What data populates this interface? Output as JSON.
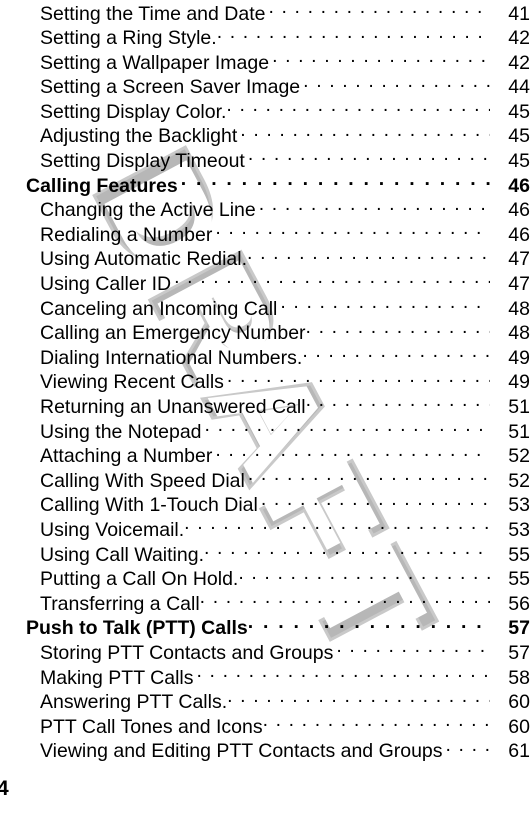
{
  "document": {
    "type": "table-of-contents",
    "watermark": "DRAFT",
    "watermark_color": "#b7b7b7",
    "folio": "4"
  },
  "toc": {
    "entries": [
      {
        "title": "Setting the Time and Date",
        "page": "41",
        "level": 2,
        "tight": false
      },
      {
        "title": "Setting a Ring Style.",
        "page": "42",
        "level": 2,
        "tight": true
      },
      {
        "title": "Setting a Wallpaper Image",
        "page": "42",
        "level": 2,
        "tight": false
      },
      {
        "title": "Setting a Screen Saver Image",
        "page": "44",
        "level": 2,
        "tight": false
      },
      {
        "title": "Setting Display Color.",
        "page": "45",
        "level": 2,
        "tight": true
      },
      {
        "title": "Adjusting the Backlight",
        "page": "45",
        "level": 2,
        "tight": false
      },
      {
        "title": "Setting Display Timeout",
        "page": "45",
        "level": 2,
        "tight": false
      },
      {
        "title": "Calling Features",
        "page": "46",
        "level": 1,
        "tight": false
      },
      {
        "title": "Changing the Active Line",
        "page": "46",
        "level": 2,
        "tight": false
      },
      {
        "title": "Redialing a Number",
        "page": "46",
        "level": 2,
        "tight": false
      },
      {
        "title": "Using Automatic Redial.",
        "page": "47",
        "level": 2,
        "tight": true
      },
      {
        "title": "Using Caller ID",
        "page": "47",
        "level": 2,
        "tight": false
      },
      {
        "title": "Canceling an Incoming Call",
        "page": "48",
        "level": 2,
        "tight": false
      },
      {
        "title": "Calling an Emergency Number",
        "page": "48",
        "level": 2,
        "tight": true
      },
      {
        "title": "Dialing International Numbers.",
        "page": "49",
        "level": 2,
        "tight": true
      },
      {
        "title": "Viewing Recent Calls",
        "page": "49",
        "level": 2,
        "tight": false
      },
      {
        "title": "Returning an Unanswered Call",
        "page": "51",
        "level": 2,
        "tight": true
      },
      {
        "title": "Using the Notepad",
        "page": "51",
        "level": 2,
        "tight": false
      },
      {
        "title": "Attaching a Number",
        "page": "52",
        "level": 2,
        "tight": false
      },
      {
        "title": "Calling With Speed Dial",
        "page": "52",
        "level": 2,
        "tight": false
      },
      {
        "title": "Calling With 1-Touch Dial",
        "page": "53",
        "level": 2,
        "tight": false
      },
      {
        "title": "Using Voicemail.",
        "page": "53",
        "level": 2,
        "tight": true
      },
      {
        "title": "Using Call Waiting.",
        "page": "55",
        "level": 2,
        "tight": true
      },
      {
        "title": "Putting a Call On Hold.",
        "page": "55",
        "level": 2,
        "tight": true
      },
      {
        "title": "Transferring a Call",
        "page": "56",
        "level": 2,
        "tight": true
      },
      {
        "title": "Push to Talk (PTT) Calls",
        "page": "57",
        "level": 1,
        "tight": true
      },
      {
        "title": "Storing PTT Contacts and Groups",
        "page": "57",
        "level": 2,
        "tight": false
      },
      {
        "title": "Making PTT Calls",
        "page": "58",
        "level": 2,
        "tight": false
      },
      {
        "title": "Answering PTT Calls.",
        "page": "60",
        "level": 2,
        "tight": true
      },
      {
        "title": "PTT Call Tones and Icons",
        "page": "60",
        "level": 2,
        "tight": true
      },
      {
        "title": "Viewing and Editing PTT Contacts and Groups",
        "page": "61",
        "level": 2,
        "tight": false
      }
    ]
  }
}
